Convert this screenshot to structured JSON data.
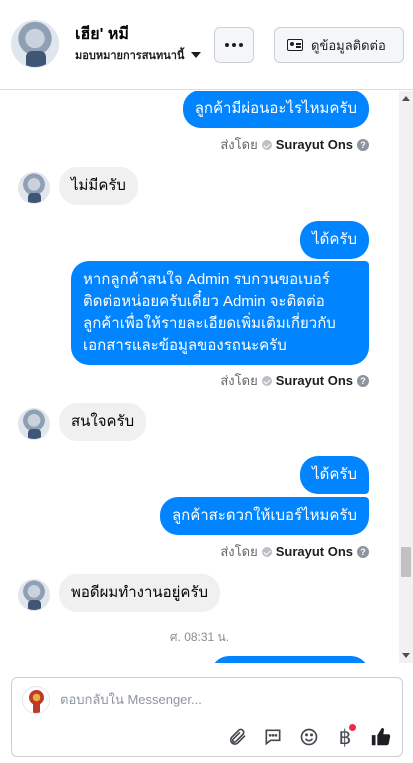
{
  "header": {
    "contact_name": "เฮีย' หมี",
    "assignment_label": "มอบหมายการสนทนานี้",
    "more_button_label": "···",
    "view_contact_label": "ดูข้อมูลติดต่อ"
  },
  "messages": [
    {
      "type": "outgoing",
      "text": "ลูกค้ามีผ่อนอะไรไหมครับ"
    },
    {
      "type": "sent_by",
      "prefix": "ส่งโดย",
      "sender": "Surayut Ons"
    },
    {
      "type": "incoming",
      "text": "ไม่มีครับ"
    },
    {
      "type": "outgoing",
      "text": "ได้ครับ"
    },
    {
      "type": "outgoing",
      "lines": [
        "หากลูกค้าสนใจ Admin รบกวนขอเบอร์",
        "ติดต่อหน่อยครับเดี๋ยว Admin จะติดต่อ",
        "ลูกค้าเพื่อให้รายละเอียดเพิ่มเติมเกี่ยวกับ",
        "เอกสารและข้อมูลของรถนะครับ"
      ]
    },
    {
      "type": "sent_by",
      "prefix": "ส่งโดย",
      "sender": "Surayut Ons"
    },
    {
      "type": "incoming",
      "text": "สนใจครับ"
    },
    {
      "type": "outgoing",
      "text": "ได้ครับ"
    },
    {
      "type": "outgoing",
      "text": "ลูกค้าสะดวกให้เบอร์ไหมครับ"
    },
    {
      "type": "sent_by",
      "prefix": "ส่งโดย",
      "sender": "Surayut Ons"
    },
    {
      "type": "incoming",
      "text": "พอดีผมทำงานอยู่ครับ"
    },
    {
      "type": "timestamp",
      "text": "ศ. 08:31 น."
    }
  ],
  "composer": {
    "placeholder": "ตอบกลับใน Messenger...",
    "tools": [
      "attachment-icon",
      "saved-replies-icon",
      "emoji-icon",
      "baht-payment-icon",
      "like-icon"
    ]
  },
  "colors": {
    "outgoing_bubble": "#0084ff",
    "incoming_bubble": "#f0f0f0",
    "notification_dot": "#f02849"
  }
}
